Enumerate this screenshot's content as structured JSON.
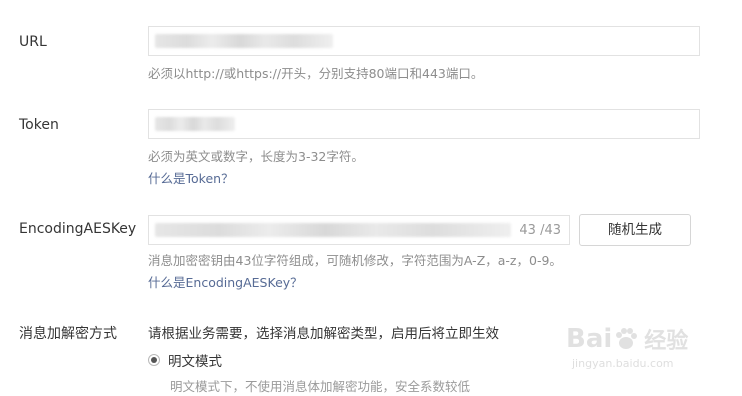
{
  "url": {
    "label": "URL",
    "hint": "必须以http://或https://开头，分别支持80端口和443端口。"
  },
  "token": {
    "label": "Token",
    "hint": "必须为英文或数字，长度为3-32字符。",
    "help_link": "什么是Token？"
  },
  "aes": {
    "label": "EncodingAESKey",
    "counter": "43 /43",
    "generate_button": "随机生成",
    "hint": "消息加密密钥由43位字符组成，可随机修改，字符范围为A-Z，a-z，0-9。",
    "help_link": "什么是EncodingAESKey？"
  },
  "encryption": {
    "label": "消息加解密方式",
    "description": "请根据业务需要，选择消息加解密类型，启用后将立即生效",
    "selected_option": "明文模式",
    "option_desc_partial": "明文模式下，不使用消息体加解密功能，安全系数较低"
  },
  "watermark": {
    "brand_left": "Bai",
    "brand_right": "经验",
    "url": "jingyan.baidu.com"
  }
}
